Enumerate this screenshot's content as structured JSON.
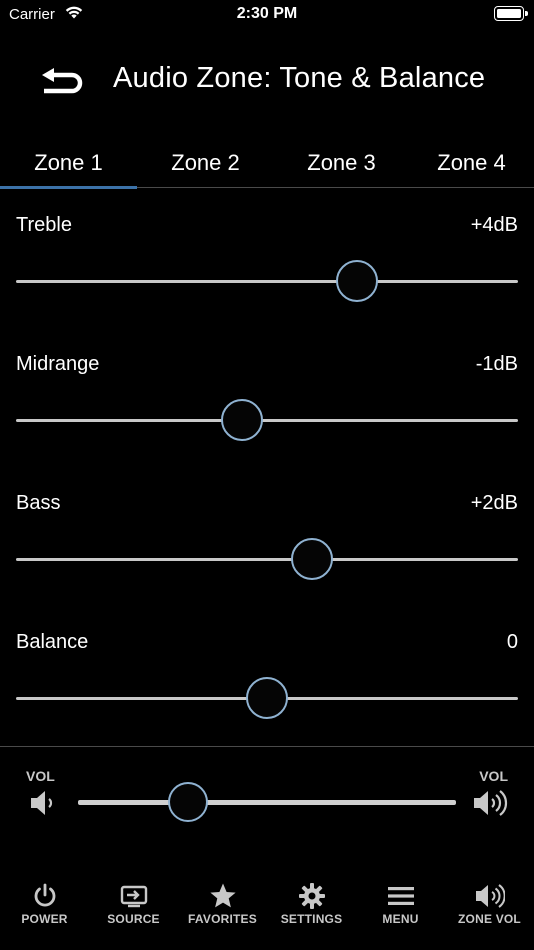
{
  "status_bar": {
    "carrier": "Carrier",
    "time": "2:30 PM",
    "battery_level": 1.0
  },
  "header": {
    "title": "Audio Zone: Tone & Balance",
    "back_icon": "back-arrow-icon"
  },
  "tabs": [
    {
      "label": "Zone 1",
      "active": true
    },
    {
      "label": "Zone 2",
      "active": false
    },
    {
      "label": "Zone 3",
      "active": false
    },
    {
      "label": "Zone 4",
      "active": false
    }
  ],
  "sliders": [
    {
      "label": "Treble",
      "value": "+4dB",
      "level": 0.68
    },
    {
      "label": "Midrange",
      "value": "-1dB",
      "level": 0.45
    },
    {
      "label": "Bass",
      "value": "+2dB",
      "level": 0.59
    },
    {
      "label": "Balance",
      "value": "0",
      "level": 0.5
    }
  ],
  "volume": {
    "left_label": "VOL",
    "right_label": "VOL",
    "level": 0.29,
    "down_icon": "speaker-low-icon",
    "up_icon": "speaker-high-icon"
  },
  "bottom_nav": [
    {
      "label": "POWER",
      "icon": "power-icon"
    },
    {
      "label": "SOURCE",
      "icon": "source-icon"
    },
    {
      "label": "FAVORITES",
      "icon": "star-icon"
    },
    {
      "label": "SETTINGS",
      "icon": "gear-icon"
    },
    {
      "label": "MENU",
      "icon": "menu-icon"
    },
    {
      "label": "ZONE VOL",
      "icon": "zone-volume-icon"
    }
  ],
  "colors": {
    "background": "#000000",
    "accent": "#3c72a8",
    "knob_border": "#8fb2d1",
    "track": "#c8c8c8"
  }
}
